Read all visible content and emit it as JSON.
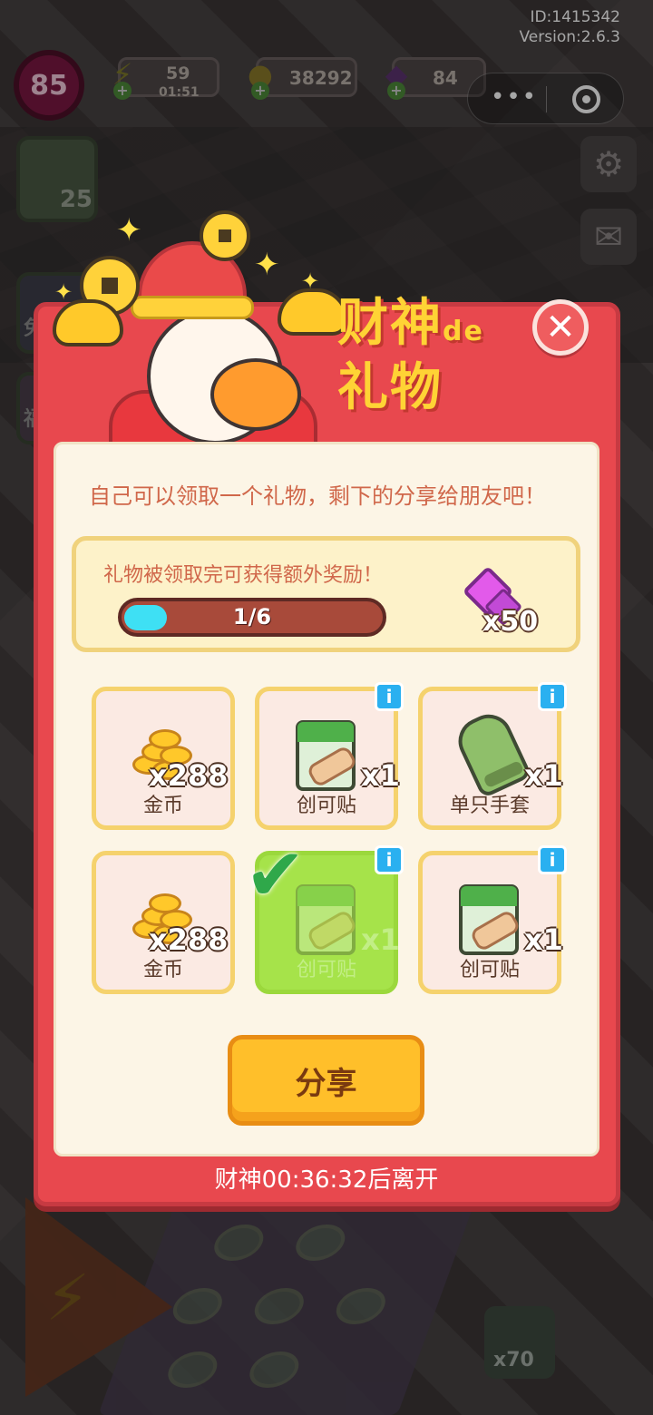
{
  "status": {
    "user_id": "ID:1415342",
    "version": "Version:2.6.3",
    "level": "85",
    "energy": "59",
    "energy_timer": "01:51",
    "coins": "38292",
    "gems": "84"
  },
  "side": {
    "left_card_count": "25",
    "left_label_1": "免",
    "left_label_2": "福",
    "bottom_plant_count": "x70"
  },
  "modal": {
    "title_line1": "财神",
    "title_de": "de",
    "title_line2": "礼物",
    "intro": "自己可以领取一个礼物，剩下的分享给朋友吧！",
    "bonus_label": "礼物被领取完可获得额外奖励！",
    "progress_text": "1/6",
    "progress_fraction": 0.1667,
    "bonus_reward": "x50",
    "gifts": [
      {
        "name": "金币",
        "qty": "x288",
        "icon": "coin-stack-icon",
        "claimed": false,
        "info": false
      },
      {
        "name": "创可贴",
        "qty": "x1",
        "icon": "bandage-icon",
        "claimed": false,
        "info": true
      },
      {
        "name": "单只手套",
        "qty": "x1",
        "icon": "glove-icon",
        "claimed": false,
        "info": true
      },
      {
        "name": "金币",
        "qty": "x288",
        "icon": "coin-stack-icon",
        "claimed": false,
        "info": false
      },
      {
        "name": "创可贴",
        "qty": "x1",
        "icon": "bandage-icon",
        "claimed": true,
        "info": true
      },
      {
        "name": "创可贴",
        "qty": "x1",
        "icon": "bandage-icon",
        "claimed": false,
        "info": true
      }
    ],
    "info_glyph": "i",
    "share_label": "分享",
    "timer_text": "财神00:36:32后离开"
  },
  "colors": {
    "modal_red": "#e8484e",
    "title_yellow": "#ffd335",
    "progress_fill": "#3ee0f4",
    "claimed_green": "#a6e34a",
    "share_orange": "#ffbf2a"
  }
}
